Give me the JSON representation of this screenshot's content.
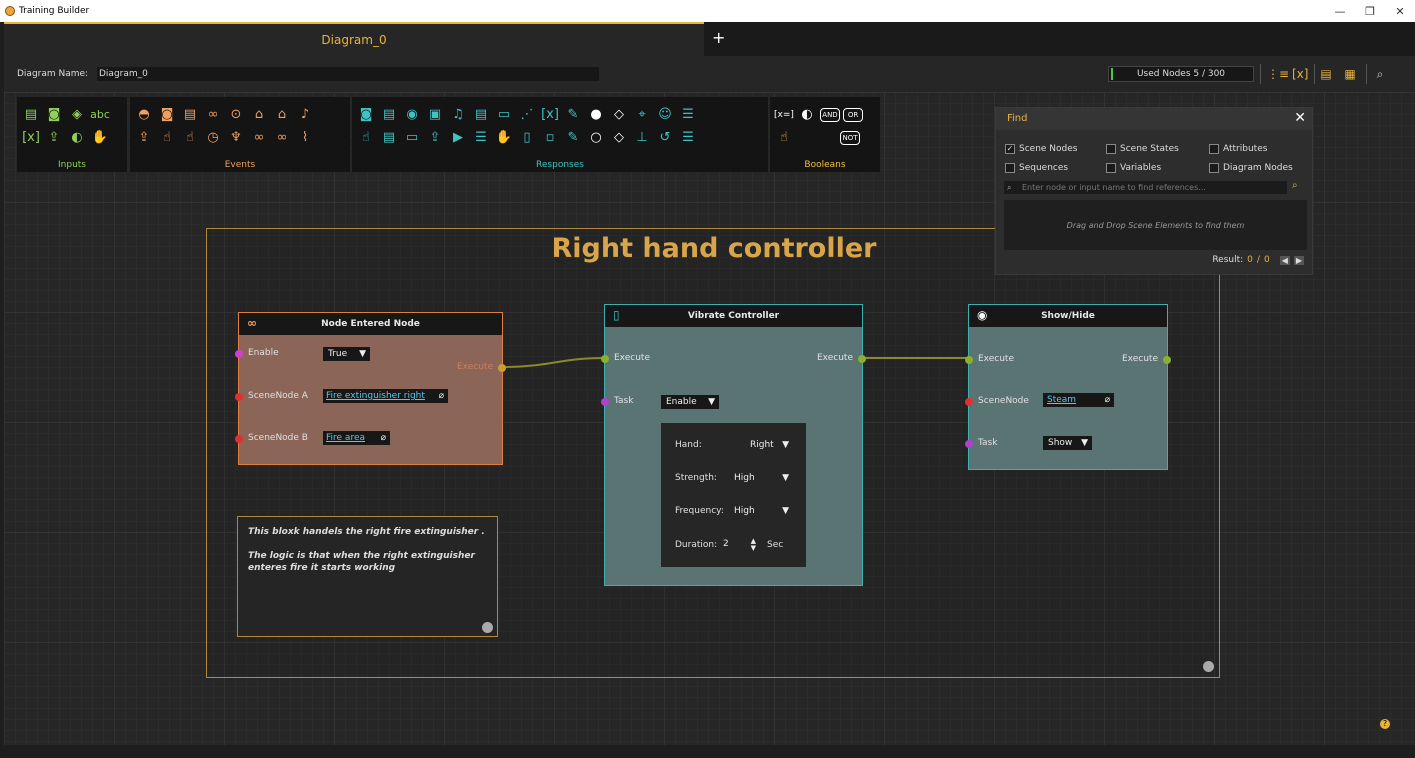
{
  "window": {
    "title": "Training Builder",
    "controls": [
      "—",
      "❐",
      "✕"
    ]
  },
  "tabs": [
    {
      "label": "Diagram_0"
    }
  ],
  "tab_add": "+",
  "diagram_name": {
    "label": "Diagram Name:",
    "value": "Diagram_0"
  },
  "used_nodes": "Used Nodes 5 / 300",
  "palette": {
    "inputs": {
      "label": "Inputs",
      "color": "#8fcf5a"
    },
    "events": {
      "label": "Events",
      "color": "#f0a060"
    },
    "responses": {
      "label": "Responses",
      "color": "#3fc3c3"
    },
    "booleans": {
      "label": "Booleans",
      "color": "#f0c040"
    }
  },
  "group": {
    "title": "Right hand controller"
  },
  "nodes": {
    "entered": {
      "title": "Node Entered Node",
      "enable_label": "Enable",
      "enable_value": "True",
      "scene_a_label": "SceneNode A",
      "scene_a_value": "Fire extinguisher right",
      "scene_b_label": "SceneNode B",
      "scene_b_value": "Fire area",
      "execute_label": "Execute"
    },
    "vibrate": {
      "title": "Vibrate Controller",
      "execute_in": "Execute",
      "execute_out": "Execute",
      "task_label": "Task",
      "task_value": "Enable",
      "hand_label": "Hand:",
      "hand_value": "Right",
      "strength_label": "Strength:",
      "strength_value": "High",
      "frequency_label": "Frequency:",
      "frequency_value": "High",
      "duration_label": "Duration:",
      "duration_value": "2",
      "duration_unit": "Sec"
    },
    "showhide": {
      "title": "Show/Hide",
      "execute_in": "Execute",
      "execute_out": "Execute",
      "scene_label": "SceneNode",
      "scene_value": "Steam",
      "task_label": "Task",
      "task_value": "Show"
    }
  },
  "comment": {
    "line1": "This bloxk handels the right fire extinguisher .",
    "line2": "The logic is that when the right extinguisher enteres fire it starts working"
  },
  "find": {
    "title": "Find",
    "options": [
      {
        "label": "Scene Nodes",
        "checked": true
      },
      {
        "label": "Scene States",
        "checked": false
      },
      {
        "label": "Attributes",
        "checked": false
      },
      {
        "label": "Sequences",
        "checked": false
      },
      {
        "label": "Variables",
        "checked": false
      },
      {
        "label": "Diagram Nodes",
        "checked": false
      }
    ],
    "search_placeholder": "Enter node or input name to find references...",
    "dropzone_text": "Drag and Drop Scene Elements to find them",
    "result_label": "Result:",
    "result_current": "0",
    "result_sep": "/",
    "result_total": "0"
  },
  "colors": {
    "accent": "#e8b33b",
    "vibrate_node": "#5a7373",
    "entered_node": "#8a6558",
    "showhide_node": "#5a7373",
    "wire": "#8a8a2a"
  }
}
